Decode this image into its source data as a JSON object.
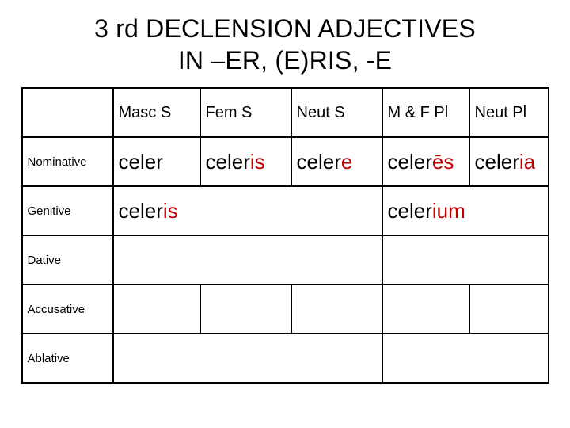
{
  "title_line1": "3 rd DECLENSION ADJECTIVES",
  "title_line2": "IN –ER, (E)RIS, -E",
  "headers": {
    "masc_s": "Masc S",
    "fem_s": "Fem S",
    "neut_s": "Neut S",
    "mf_pl": "M & F Pl",
    "neut_pl": "Neut Pl"
  },
  "cases": {
    "nominative": "Nominative",
    "genitive": "Genitive",
    "dative": "Dative",
    "accusative": "Accusative",
    "ablative": "Ablative"
  },
  "nom": {
    "masc": {
      "stem": "celer",
      "end": ""
    },
    "fem": {
      "stem": "celer",
      "end": "is"
    },
    "neut": {
      "stem": "celer",
      "end": "e"
    },
    "mfpl": {
      "stem": "celer",
      "end": "ēs"
    },
    "npl": {
      "stem": "celer",
      "end": "ia"
    }
  },
  "gen": {
    "sing": {
      "stem": "celer",
      "end": "is"
    },
    "pl": {
      "stem": "celer",
      "end": "ium"
    }
  },
  "chart_data": {
    "type": "table",
    "title": "3rd Declension Adjectives in –ER, (E)RIS, -E",
    "columns": [
      "",
      "Masc S",
      "Fem S",
      "Neut S",
      "M & F Pl",
      "Neut Pl"
    ],
    "rows": [
      [
        "Nominative",
        "celer",
        "celeris",
        "celere",
        "celerēs",
        "celeria"
      ],
      [
        "Genitive",
        "celeris",
        "celeris",
        "celeris",
        "celerium",
        "celerium"
      ],
      [
        "Dative",
        "",
        "",
        "",
        "",
        ""
      ],
      [
        "Accusative",
        "",
        "",
        "",
        "",
        ""
      ],
      [
        "Ablative",
        "",
        "",
        "",
        "",
        ""
      ]
    ]
  }
}
